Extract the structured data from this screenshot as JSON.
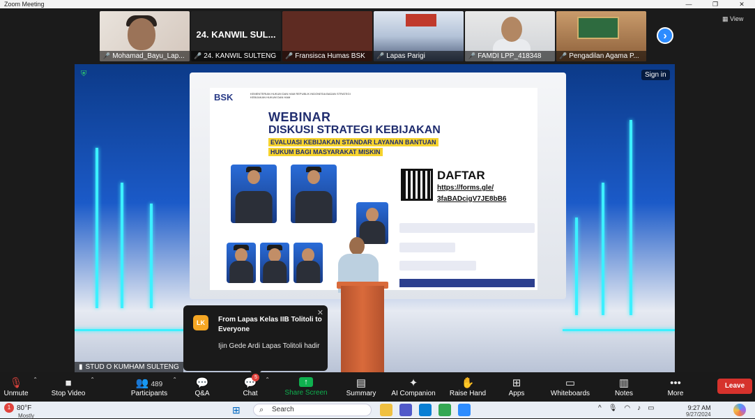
{
  "window": {
    "title": "Zoom Meeting",
    "minimize": "—",
    "restore": "❐",
    "close": "✕"
  },
  "thumbnails": [
    {
      "label": "Mohamad_Bayu_Lap..."
    },
    {
      "label": "24. KANWIL SULTENG",
      "center_name": "24. KANWIL SUL..."
    },
    {
      "label": "Fransisca Humas BSK"
    },
    {
      "label": "Lapas Parigi"
    },
    {
      "label": "FAMDI LPP_418348"
    },
    {
      "label": "Pengadilan Agama P..."
    }
  ],
  "view_button": "View",
  "main_video": {
    "sign_in": "Sign in",
    "label": "STUD O KUMHAM SULTENG",
    "slide": {
      "brand": "BSK",
      "ministry": "KEMENTERIAN HUKUM DAN HAM REPUBLIK INDONESIA BADAN STRATEGI KEBIJAKAN HUKUM DAN HAM",
      "webinar": "WEBINAR",
      "title": "DISKUSI STRATEGI KEBIJAKAN",
      "subtitle1": "EVALUASI KEBIJAKAN STANDAR LAYANAN BANTUAN",
      "subtitle2": "HUKUM BAGI MASYARAKAT MISKIN",
      "register": "DAFTAR",
      "link1": "https://forms.gle/",
      "link2": "3faBADcigV7JE8bB6"
    }
  },
  "chat_popup": {
    "avatar": "LK",
    "from": "From Lapas Kelas IIB Tolitoli to Everyone",
    "message": "Ijin Gede Ardi Lapas Tolitoli hadir",
    "close": "✕"
  },
  "toolbar": {
    "unmute": "Unmute",
    "stop_video": "Stop Video",
    "participants": "Participants",
    "participants_count": "489",
    "qa": "Q&A",
    "chat": "Chat",
    "chat_badge": "5",
    "share": "Share Screen",
    "summary": "Summary",
    "ai": "AI Companion",
    "raise": "Raise Hand",
    "apps": "Apps",
    "whiteboards": "Whiteboards",
    "notes": "Notes",
    "more": "More",
    "leave": "Leave"
  },
  "taskbar": {
    "weather_badge": "1",
    "temp": "80°F",
    "weather_sub": "Mostly",
    "search": "Search",
    "time": "9:27 AM",
    "date": "9/27/2024"
  },
  "colors": {
    "accent": "#2d8cff",
    "share": "#0fb04f",
    "leave": "#d6322c"
  }
}
